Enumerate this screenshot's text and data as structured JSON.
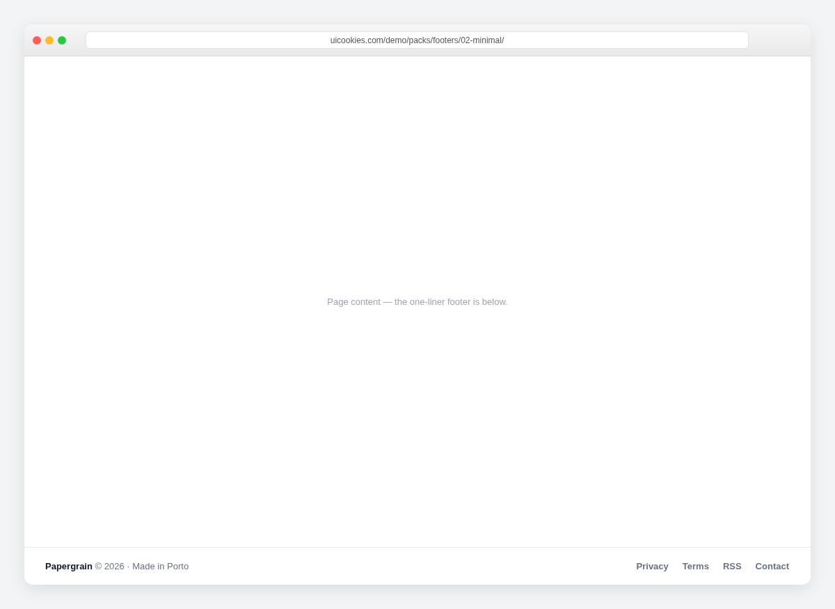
{
  "browser": {
    "url": "uicookies.com/demo/packs/footers/02-minimal/"
  },
  "content": {
    "message": "Page content — the one-liner footer is below."
  },
  "footer": {
    "note": "**Papergrain** © 2026 · Made in Porto",
    "links": [
      "Privacy",
      "Terms",
      "RSS",
      "Contact"
    ]
  }
}
